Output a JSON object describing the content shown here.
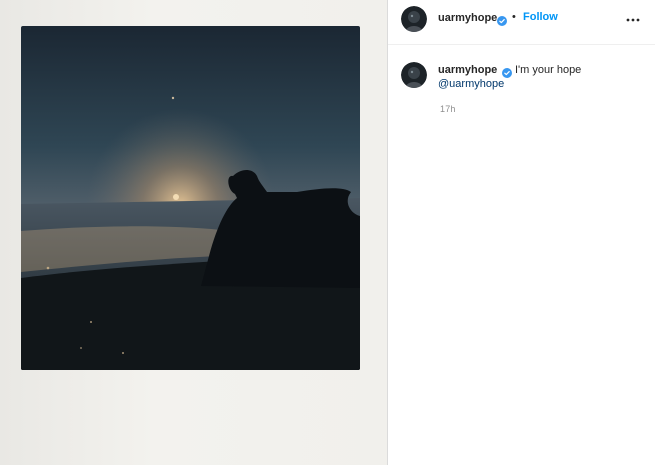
{
  "post": {
    "author": "uarmyhope",
    "separator": "•",
    "follow_label": "Follow",
    "caption_username": "uarmyhope",
    "caption_text": "I'm your hope",
    "caption_mention": "@uarmyhope",
    "time_ago": "17h"
  },
  "icons": {
    "verified": "verified-badge-icon",
    "more": "more-options-icon"
  },
  "colors": {
    "follow": "#0095f6",
    "verified": "#3897f0",
    "text": "#262626",
    "muted": "#8e8e8e"
  }
}
